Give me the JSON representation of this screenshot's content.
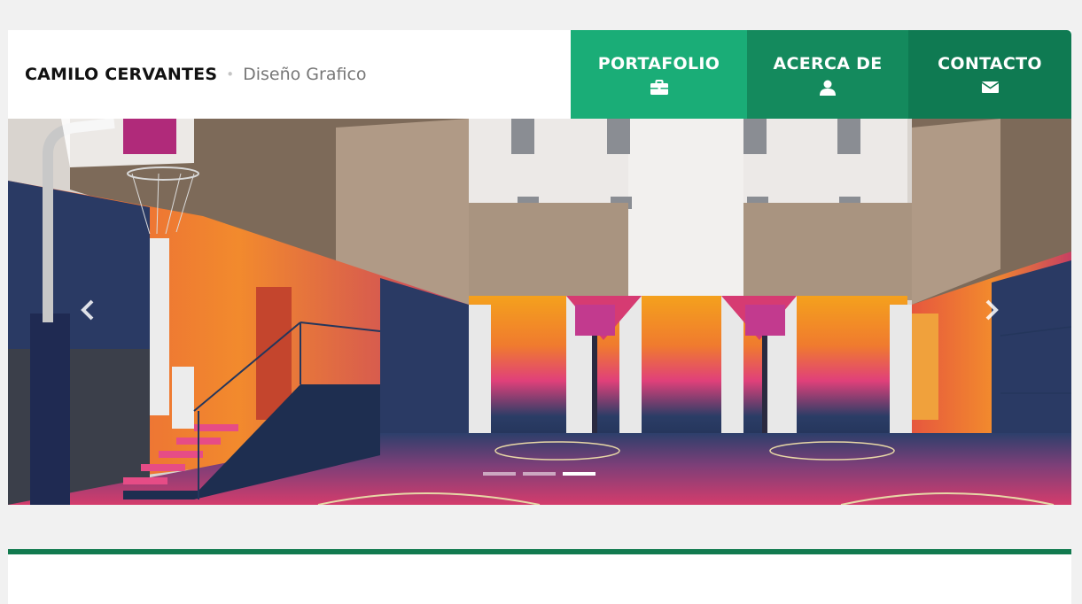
{
  "header": {
    "name": "CAMILO CERVANTES",
    "separator": "•",
    "role": "Diseño Grafico"
  },
  "nav": {
    "items": [
      {
        "label": "PORTAFOLIO",
        "icon": "briefcase-icon"
      },
      {
        "label": "ACERCA DE",
        "icon": "user-icon"
      },
      {
        "label": "CONTACTO",
        "icon": "envelope-icon"
      }
    ]
  },
  "carousel": {
    "slide_count": 3,
    "active_index": 2,
    "prev_icon": "chevron-left-icon",
    "next_icon": "chevron-right-icon"
  },
  "colors": {
    "nav_portafolio": "#1aad77",
    "nav_acerca": "#148a5d",
    "nav_contacto": "#0f7a52",
    "accent_bar": "#127a4f",
    "page_bg": "#f1f1f1"
  }
}
